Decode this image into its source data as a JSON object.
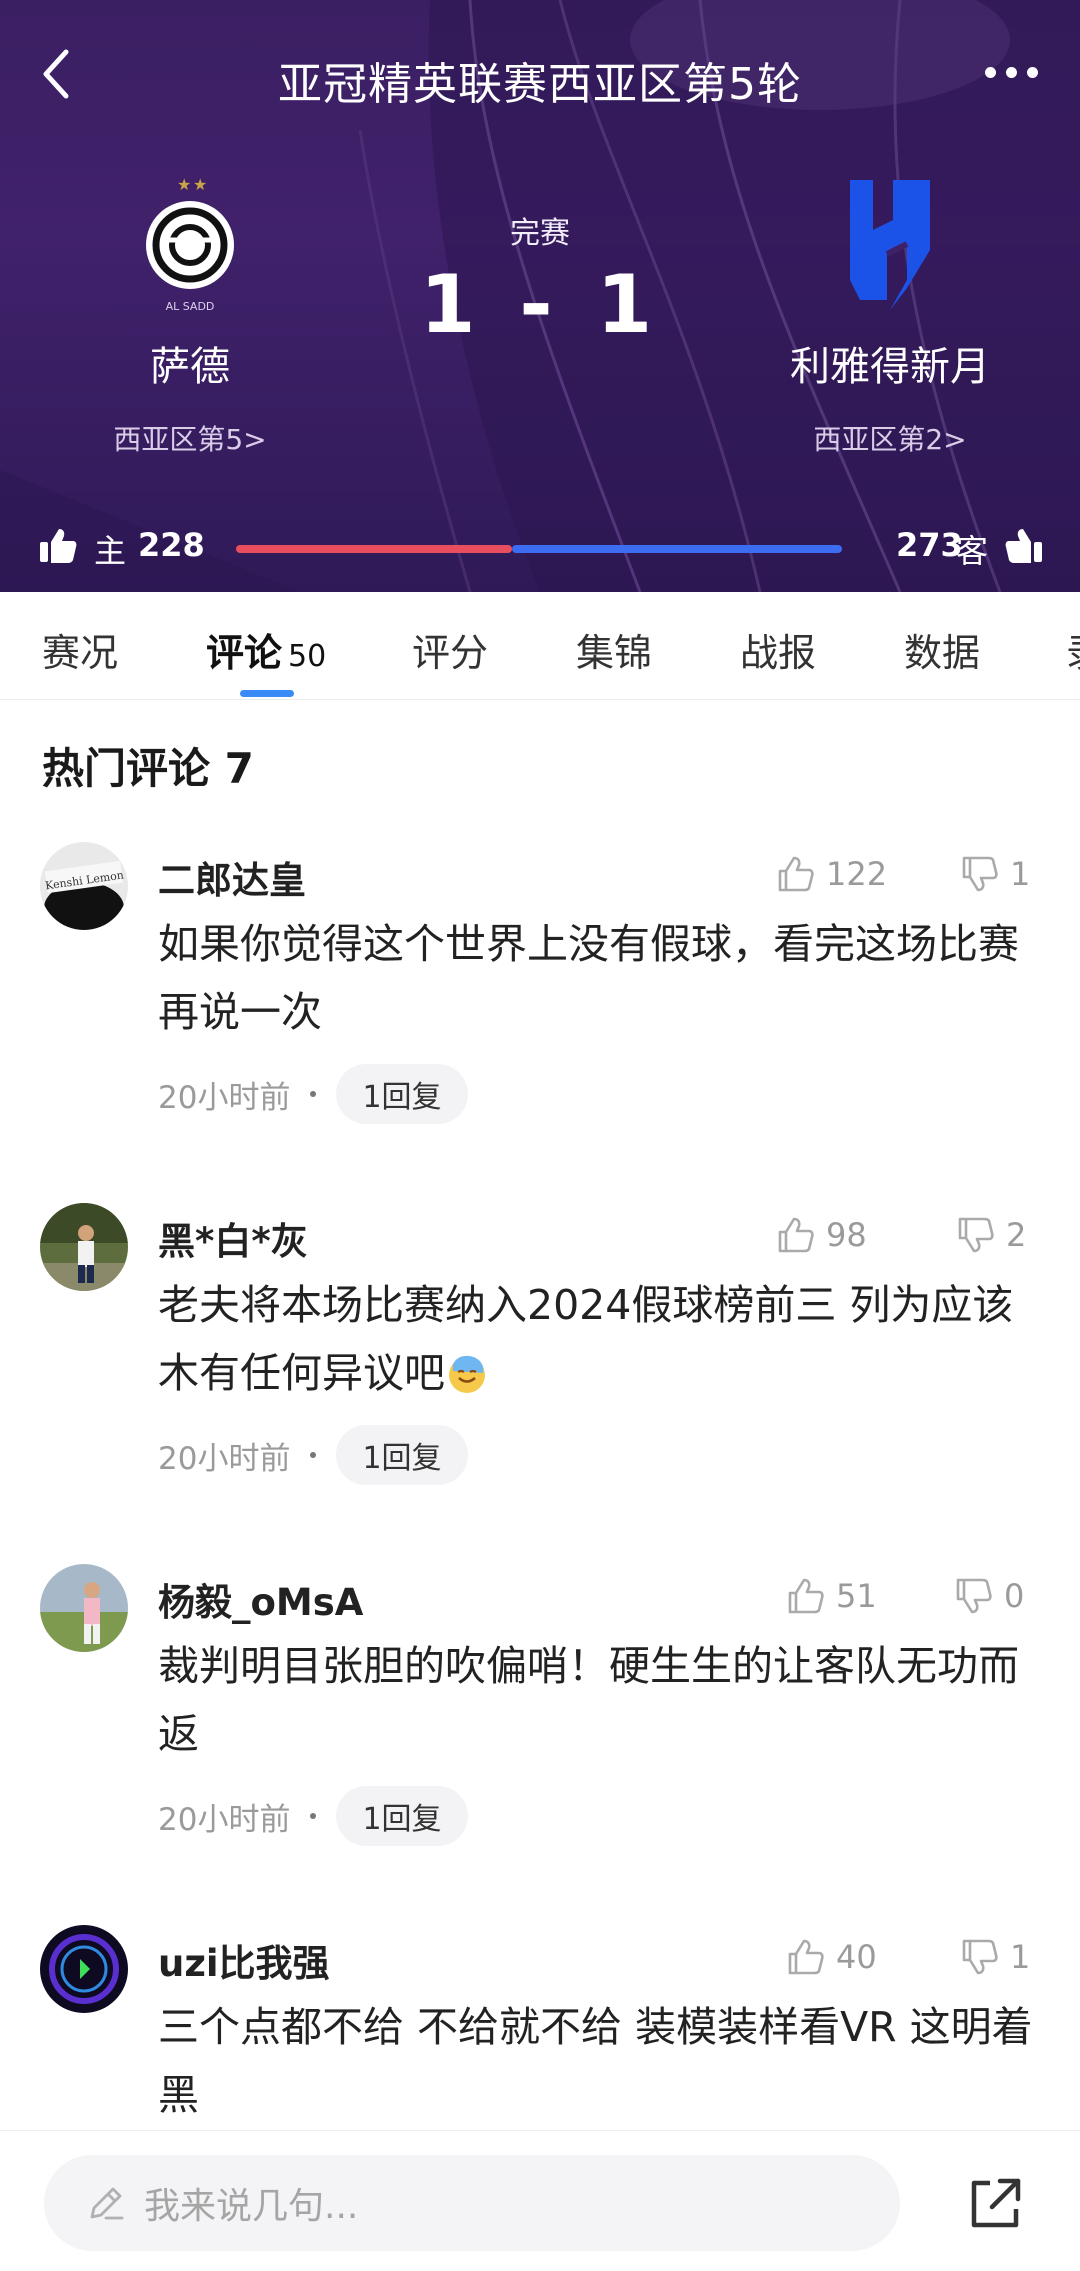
{
  "header": {
    "title": "亚冠精英联赛西亚区第5轮",
    "status": "完赛",
    "score": "1 - 1",
    "home": {
      "name": "萨德",
      "rank": "西亚区第5>"
    },
    "away": {
      "name": "利雅得新月",
      "rank": "西亚区第2>"
    },
    "vote": {
      "home_label": "主",
      "home_count": "228",
      "away_label": "客",
      "away_count": "273",
      "home_share": 0.455
    }
  },
  "tabs": [
    {
      "label": "赛况"
    },
    {
      "label": "评论",
      "count": "50"
    },
    {
      "label": "评分"
    },
    {
      "label": "集锦"
    },
    {
      "label": "战报"
    },
    {
      "label": "数据"
    },
    {
      "label": "录"
    }
  ],
  "hot": {
    "title": "热门评论 7"
  },
  "comments": [
    {
      "user": "二郎达皇",
      "likes": "122",
      "dislikes": "1",
      "text": "如果你觉得这个世界上没有假球，看完这场比赛再说一次",
      "time": "20小时前",
      "replies": "1回复"
    },
    {
      "user": "黑*白*灰",
      "likes": "98",
      "dislikes": "2",
      "text": "老夫将本场比赛纳入2024假球榜前三 列为应该木有任何异议吧",
      "time": "20小时前",
      "replies": "1回复"
    },
    {
      "user": "杨毅_oMsA",
      "likes": "51",
      "dislikes": "0",
      "text": "裁判明目张胆的吹偏哨！硬生生的让客队无功而返",
      "time": "20小时前",
      "replies": "1回复"
    },
    {
      "user": "uzi比我强",
      "likes": "40",
      "dislikes": "1",
      "text": "三个点都不给 不给就不给 装模装样看VR 这明着黑"
    }
  ],
  "bottom": {
    "placeholder": "我来说几句..."
  },
  "colors": {
    "header_bg": "#3b1f63",
    "home_bar": "#e84e5d",
    "away_bar": "#3b6cf2",
    "tab_indicator": "#3a8bf5"
  }
}
